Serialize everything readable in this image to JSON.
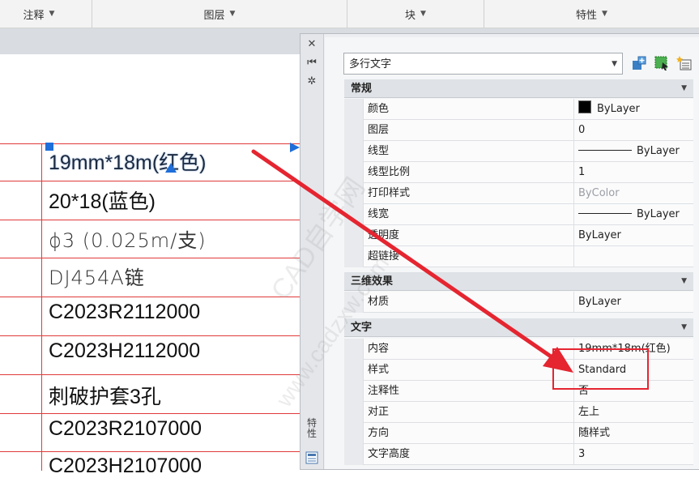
{
  "ribbon": {
    "sections": [
      {
        "label": "注释"
      },
      {
        "label": "图层"
      },
      {
        "label": "块"
      },
      {
        "label": "特性"
      }
    ]
  },
  "table": {
    "rows": [
      {
        "text": "19mm*18m(红色)"
      },
      {
        "text": "20*18(蓝色)"
      },
      {
        "text": "ϕ3 (0.025m/支)"
      },
      {
        "text": "DJ454A链"
      },
      {
        "text": "C2023R2112000"
      },
      {
        "text": "C2023H2112000"
      },
      {
        "text": "刺破护套3孔"
      },
      {
        "text": "C2023R2107000"
      },
      {
        "text": "C2023H2107000"
      }
    ]
  },
  "palette": {
    "side_label": "特性",
    "object_type": "多行文字",
    "sections": {
      "general": "常规",
      "three_d": "三维效果",
      "text": "文字"
    },
    "general_rows": [
      {
        "label": "颜色",
        "value": "ByLayer"
      },
      {
        "label": "图层",
        "value": "0"
      },
      {
        "label": "线型",
        "value": "ByLayer"
      },
      {
        "label": "线型比例",
        "value": "1"
      },
      {
        "label": "打印样式",
        "value": "ByColor"
      },
      {
        "label": "线宽",
        "value": "ByLayer"
      },
      {
        "label": "透明度",
        "value": "ByLayer"
      },
      {
        "label": "超链接",
        "value": ""
      }
    ],
    "three_d_rows": [
      {
        "label": "材质",
        "value": "ByLayer"
      }
    ],
    "text_rows": [
      {
        "label": "内容",
        "value": "19mm*18m(红色)"
      },
      {
        "label": "样式",
        "value": "Standard"
      },
      {
        "label": "注释性",
        "value": "否"
      },
      {
        "label": "对正",
        "value": "左上"
      },
      {
        "label": "方向",
        "value": "随样式"
      },
      {
        "label": "文字高度",
        "value": "3"
      }
    ]
  },
  "watermark": {
    "line1": "CAD自学网",
    "line2": "www.cadzxw.com"
  },
  "colors": {
    "table_line": "#e03a3a",
    "annotation": "#e52530",
    "grip": "#1e6fd9"
  }
}
